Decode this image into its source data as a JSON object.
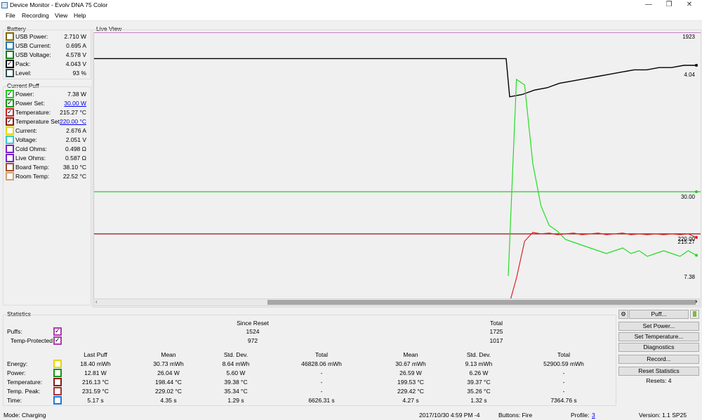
{
  "window": {
    "title": "Device Monitor - Evolv DNA 75 Color",
    "minimize": "—",
    "restore": "❐",
    "close": "✕"
  },
  "menu": [
    "File",
    "Recording",
    "View",
    "Help"
  ],
  "battery": {
    "label": "Battery",
    "rows": [
      {
        "label": "USB Power:",
        "value": "2.710 W",
        "color": "#7f6a00",
        "checked": false
      },
      {
        "label": "USB Current:",
        "value": "0.695 A",
        "color": "#1f77b4",
        "checked": false
      },
      {
        "label": "USB Voltage:",
        "value": "4.578 V",
        "color": "#1b7a1b",
        "checked": false
      },
      {
        "label": "Pack:",
        "value": "4.043 V",
        "color": "#000000",
        "checked": true
      },
      {
        "label": "Level:",
        "value": "93 %",
        "color": "#2f4f4f",
        "checked": false
      }
    ]
  },
  "current_puff": {
    "label": "Current Puff",
    "rows": [
      {
        "label": "Power:",
        "value": "7.38 W",
        "color": "#22cc22",
        "checked": true,
        "link": false
      },
      {
        "label": "Power Set:",
        "value": "30.00 W",
        "color": "#119911",
        "checked": true,
        "link": true
      },
      {
        "label": "Temperature:",
        "value": "215.27 °C",
        "color": "#cc2222",
        "checked": true,
        "link": false
      },
      {
        "label": "Temperature Set:",
        "value": "220.00 °C",
        "color": "#8b1a1a",
        "checked": true,
        "link": true
      },
      {
        "label": "Current:",
        "value": "2.676 A",
        "color": "#e6d600",
        "checked": false,
        "link": false
      },
      {
        "label": "Voltage:",
        "value": "2.051 V",
        "color": "#33cccc",
        "checked": false,
        "link": false
      },
      {
        "label": "Cold Ohms:",
        "value": "0.498 Ω",
        "color": "#7a22cc",
        "checked": false,
        "link": false
      },
      {
        "label": "Live Ohms:",
        "value": "0.587 Ω",
        "color": "#7a22cc",
        "checked": false,
        "link": false
      },
      {
        "label": "Board Temp:",
        "value": "38.10 °C",
        "color": "#a0522d",
        "checked": false,
        "link": false
      },
      {
        "label": "Room Temp:",
        "value": "22.52 °C",
        "color": "#d2a070",
        "checked": false,
        "link": false
      }
    ]
  },
  "live_view": {
    "label": "Live View",
    "y_labels": [
      "1923",
      "4.04",
      "30.00",
      "220.00",
      "215.27",
      "7.38"
    ],
    "colors": {
      "level": "#b03cb0",
      "pack": "#000000",
      "power_set": "#22cc22",
      "power": "#22dd22",
      "temp": "#dd2222",
      "temp_set": "#991111"
    },
    "scroll_left": "‹",
    "scroll_right": "⏵",
    "chart_data": {
      "type": "line",
      "series": [
        {
          "values": [
            4.07,
            4.07,
            4.07,
            4.07,
            4.07,
            4.07,
            4.07,
            4.07,
            4.07,
            4.07,
            4.07,
            4.07,
            4.07,
            4.07,
            4.07,
            4.07,
            4.07,
            4.07,
            4.07,
            4.07,
            3.9,
            3.91,
            3.93,
            3.94,
            3.96,
            3.97,
            3.98,
            3.99,
            4.0,
            4.01,
            4.02,
            4.02,
            4.03,
            4.03,
            4.04,
            4.04
          ]
        },
        {
          "values": [
            30.0,
            30.0
          ]
        },
        {
          "values": [
            220.0,
            220.0
          ]
        },
        {
          "values": [
            0,
            70,
            68,
            40,
            25,
            18,
            16,
            13,
            12,
            11,
            10,
            9,
            8,
            9,
            10,
            8,
            9,
            7,
            8,
            9,
            8,
            7,
            9,
            7.38
          ]
        },
        {
          "values": [
            120,
            160,
            210,
            222,
            220,
            221,
            219,
            220,
            221,
            219,
            220,
            221,
            219,
            220,
            221,
            219,
            220,
            219,
            220,
            219,
            220,
            219,
            220,
            215.27
          ]
        }
      ]
    }
  },
  "statistics": {
    "label": "Statistics",
    "since_reset": "Since Reset",
    "total": "Total",
    "puffs_label": "Puffs:",
    "temp_protected_label": "Temp-Protected:",
    "puffs_since": "1524",
    "puffs_total": "1725",
    "tp_since": "972",
    "tp_total": "1017",
    "headers": [
      "Last Puff",
      "Mean",
      "Std. Dev.",
      "Total",
      "Mean",
      "Std. Dev.",
      "Total"
    ],
    "rows": [
      {
        "label": "Energy:",
        "color": "#e6d600",
        "values": [
          "18.40 mWh",
          "30.73 mWh",
          "8.64 mWh",
          "46828.06 mWh",
          "30.67 mWh",
          "9.13 mWh",
          "52900.59 mWh"
        ]
      },
      {
        "label": "Power:",
        "color": "#119911",
        "values": [
          "12.81 W",
          "26.04 W",
          "5.60 W",
          "-",
          "26.59 W",
          "6.26 W",
          "-"
        ]
      },
      {
        "label": "Temperature:",
        "color": "#8b1a1a",
        "values": [
          "216.13 °C",
          "198.44 °C",
          "39.38 °C",
          "-",
          "199.53 °C",
          "39.37 °C",
          "-"
        ]
      },
      {
        "label": "Temp. Peak:",
        "color": "#aa3333",
        "values": [
          "231.59 °C",
          "229.02 °C",
          "35.34 °C",
          "-",
          "229.42 °C",
          "35.26 °C",
          "-"
        ]
      },
      {
        "label": "Time:",
        "color": "#2277dd",
        "values": [
          "5.17 s",
          "4.35 s",
          "1.29 s",
          "6626.31 s",
          "4.27 s",
          "1.32 s",
          "7364.76 s"
        ]
      }
    ],
    "puffs_color": "#b03cb0"
  },
  "buttons": {
    "puff": "Puff...",
    "set_power": "Set Power...",
    "set_temperature": "Set Temperature...",
    "diagnostics": "Diagnostics",
    "record": "Record...",
    "reset_statistics": "Reset Statistics",
    "resets": "Resets: 4"
  },
  "status": {
    "mode": "Mode: Charging",
    "datetime": "2017/10/30 4:59 PM -4",
    "buttons": "Buttons: Fire",
    "profile_label": "Profile:",
    "profile_value": "3",
    "version": "Version: 1.1 SP25"
  }
}
